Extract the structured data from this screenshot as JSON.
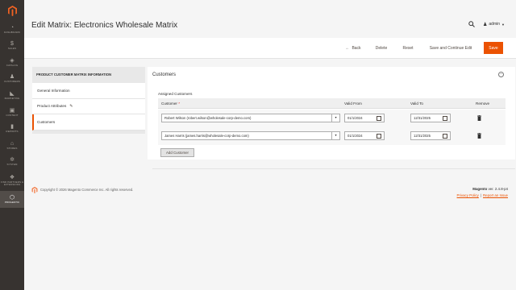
{
  "sidebar": {
    "items": [
      {
        "label": "Dashboard",
        "icon": "dashboard-icon",
        "glyph": "◔"
      },
      {
        "label": "Sales",
        "icon": "dollar-icon",
        "glyph": "$"
      },
      {
        "label": "Catalog",
        "icon": "cube-icon",
        "glyph": "◈"
      },
      {
        "label": "Customers",
        "icon": "person-icon",
        "glyph": "♟"
      },
      {
        "label": "Marketing",
        "icon": "megaphone-icon",
        "glyph": "◣"
      },
      {
        "label": "Content",
        "icon": "layout-icon",
        "glyph": "▣"
      },
      {
        "label": "Reports",
        "icon": "bar-chart-icon",
        "glyph": "▮"
      },
      {
        "label": "Stores",
        "icon": "store-icon",
        "glyph": "⌂"
      },
      {
        "label": "System",
        "icon": "gear-icon",
        "glyph": "✲"
      },
      {
        "label": "Find Partners & Extensions",
        "icon": "puzzle-icon",
        "glyph": "❖"
      },
      {
        "label": "Progestic",
        "icon": "hexagon-icon",
        "glyph": "⬡"
      }
    ]
  },
  "header": {
    "title": "Edit Matrix: Electronics Wholesale Matrix",
    "user": "admin"
  },
  "actions": {
    "back": "Back",
    "delete": "Delete",
    "reset": "Reset",
    "save_continue": "Save and Continue Edit",
    "save": "Save"
  },
  "tabs": {
    "heading": "Product Customer Matrix Information",
    "items": [
      "General Information",
      "Product Attributes",
      "Customers"
    ]
  },
  "panel": {
    "title": "Customers",
    "assigned_label": "Assigned Customers",
    "columns": {
      "customer": "Customer",
      "required_mark": "*",
      "valid_from": "Valid From",
      "valid_to": "Valid To",
      "remove": "Remove"
    },
    "rows": [
      {
        "customer": "Robert Wilson (robert.wilson@wholesale-corp-demo.com)",
        "valid_from": "01/1/2024",
        "valid_to": "12/31/2025"
      },
      {
        "customer": "James Harris (james.harris@wholesale-corp-demo.com)",
        "valid_from": "01/1/2024",
        "valid_to": "12/31/2025"
      }
    ],
    "add_button": "Add Customer"
  },
  "footer": {
    "copyright": "Copyright © 2026 Magento Commerce Inc. All rights reserved.",
    "brand": "Magento",
    "version": "ver. 2.4.8-p4",
    "privacy": "Privacy Policy",
    "separator": "|",
    "report": "Report an Issue"
  },
  "colors": {
    "accent": "#eb5202",
    "sidebar": "#373330"
  }
}
